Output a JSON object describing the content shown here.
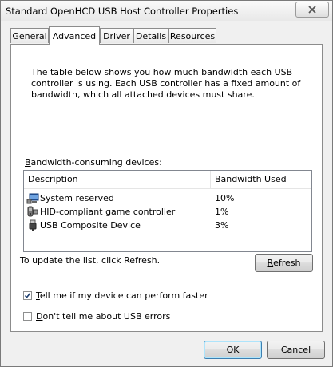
{
  "window": {
    "title": "Standard OpenHCD USB Host Controller Properties"
  },
  "tabs": [
    {
      "label": "General",
      "active": false
    },
    {
      "label": "Advanced",
      "active": true
    },
    {
      "label": "Driver",
      "active": false
    },
    {
      "label": "Details",
      "active": false
    },
    {
      "label": "Resources",
      "active": false
    }
  ],
  "advanced": {
    "description": "The table below shows you how much bandwidth each USB controller is using. Each USB controller has a fixed amount of bandwidth, which all attached devices must share.",
    "devices_label": "Bandwidth-consuming devices:",
    "columns": {
      "description": "Description",
      "bandwidth": "Bandwidth Used"
    },
    "devices": [
      {
        "name": "System reserved",
        "bandwidth": "10%",
        "icon": "usb-hub-icon"
      },
      {
        "name": "HID-compliant game controller",
        "bandwidth": "1%",
        "icon": "game-controller-icon"
      },
      {
        "name": "USB Composite Device",
        "bandwidth": "3%",
        "icon": "usb-plug-icon"
      }
    ],
    "refresh_hint": "To update the list, click Refresh.",
    "refresh_button": "Refresh",
    "options": [
      {
        "label": "Tell me if my device can perform faster",
        "checked": true
      },
      {
        "label": "Don't tell me about USB errors",
        "checked": false
      }
    ]
  },
  "buttons": {
    "ok": "OK",
    "cancel": "Cancel"
  }
}
